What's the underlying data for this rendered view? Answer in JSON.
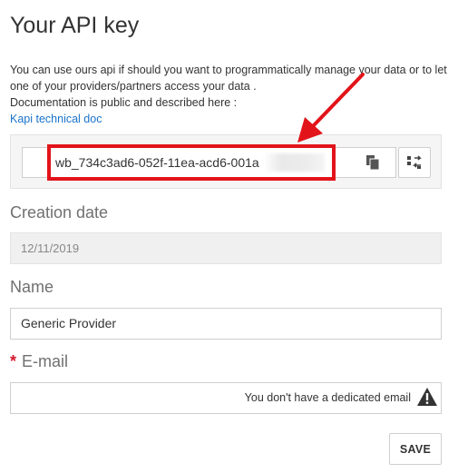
{
  "page": {
    "title": "Your API key",
    "description_line1": "You can use ours api if should you want to programmatically manage your data or to let one of your providers/partners access your data .",
    "description_line2": "Documentation is public and described here :",
    "doc_link": "Kapi technical doc"
  },
  "api_key": {
    "value": "wb_734c3ad6-052f-11ea-acd6-001a"
  },
  "creation_date": {
    "label": "Creation date",
    "value": "12/11/2019"
  },
  "name": {
    "label": "Name",
    "value": "Generic Provider"
  },
  "email": {
    "required_mark": "*",
    "label": "E-mail",
    "hint": "You don't have a dedicated email"
  },
  "actions": {
    "save": "SAVE"
  },
  "colors": {
    "highlight": "#e2141a",
    "link": "#1a73c9",
    "required": "#d6182d"
  }
}
